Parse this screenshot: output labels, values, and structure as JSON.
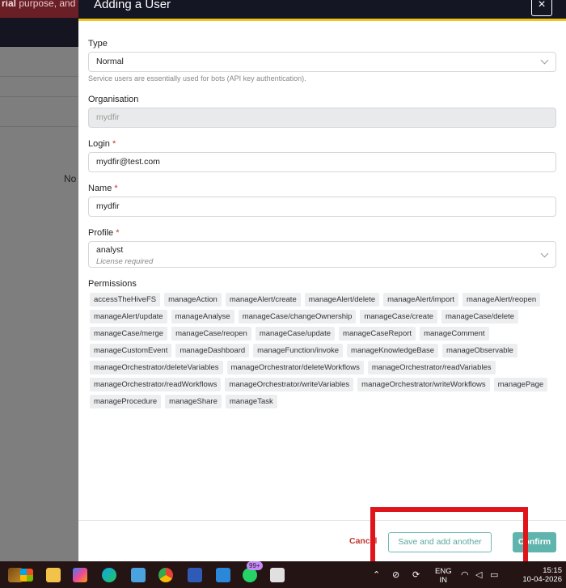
{
  "background": {
    "banner_text_bold": "rial",
    "banner_text": " purpose, and wi",
    "no_text": "No c"
  },
  "drawer": {
    "title": "Adding a User",
    "close_symbol": "×",
    "type": {
      "label": "Type",
      "value": "Normal",
      "help": "Service users are essentially used for bots (API key authentication)."
    },
    "organisation": {
      "label": "Organisation",
      "value": "mydfir"
    },
    "login": {
      "label": "Login",
      "required_mark": "*",
      "value": "mydfir@test.com"
    },
    "name": {
      "label": "Name",
      "required_mark": "*",
      "value": "mydfir"
    },
    "profile": {
      "label": "Profile",
      "required_mark": "*",
      "value": "analyst",
      "note": "License required"
    },
    "permissions": {
      "label": "Permissions",
      "items": [
        "accessTheHiveFS",
        "manageAction",
        "manageAlert/create",
        "manageAlert/delete",
        "manageAlert/import",
        "manageAlert/reopen",
        "manageAlert/update",
        "manageAnalyse",
        "manageCase/changeOwnership",
        "manageCase/create",
        "manageCase/delete",
        "manageCase/merge",
        "manageCase/reopen",
        "manageCase/update",
        "manageCaseReport",
        "manageComment",
        "manageCustomEvent",
        "manageDashboard",
        "manageFunction/invoke",
        "manageKnowledgeBase",
        "manageObservable",
        "manageOrchestrator/deleteVariables",
        "manageOrchestrator/deleteWorkflows",
        "manageOrchestrator/readVariables",
        "manageOrchestrator/readWorkflows",
        "manageOrchestrator/writeVariables",
        "manageOrchestrator/writeWorkflows",
        "managePage",
        "manageProcedure",
        "manageShare",
        "manageTask"
      ]
    },
    "footer": {
      "cancel": "Cancel",
      "save_and_add": "Save and add another",
      "confirm": "Confirm"
    }
  },
  "taskbar": {
    "lang_top": "ENG",
    "lang_bottom": "IN",
    "time": "15:15",
    "date": "10-04-2026",
    "whatsapp_badge": "99+",
    "icons": [
      "windows-start-icon",
      "widgets-icon",
      "file-explorer-icon",
      "copilot-icon",
      "edge-icon",
      "notepad-icon",
      "chrome-icon",
      "virtualbox-icon",
      "vscode-icon",
      "whatsapp-icon",
      "snipping-tool-icon"
    ],
    "colors": {
      "accent": "#f0c419",
      "confirm": "#5fb5ad",
      "required": "#c0392b",
      "highlight": "#e0141b"
    }
  }
}
